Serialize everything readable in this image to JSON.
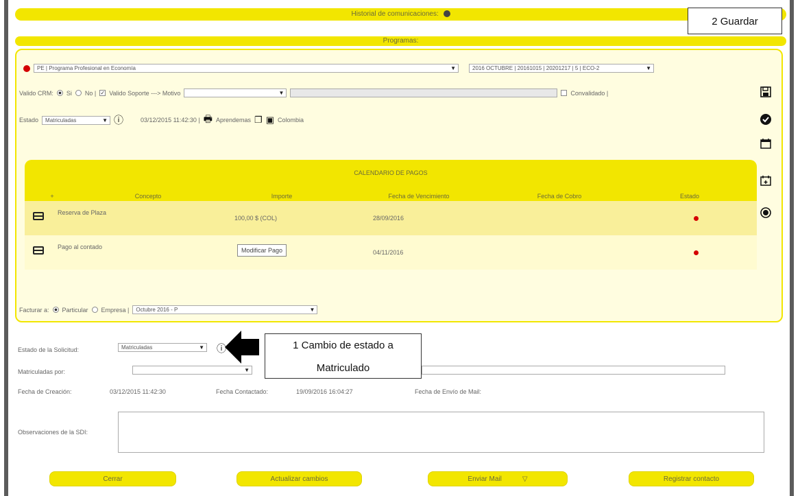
{
  "header": {
    "historial_label": "Historial de comunicaciones:",
    "programas_label": "Programas:"
  },
  "callouts": {
    "guardar": "2 Guardar",
    "cambio_line1": "1 Cambio de estado a",
    "cambio_line2": "Matriculado"
  },
  "program": {
    "program_select": "PE | Programa Profesional en Economía",
    "period_select": "2016 OCTUBRE | 20161015 | 20201217 | 5 | ECO-2",
    "valido_crm_label": "Valido CRM:",
    "si_label": "Si",
    "no_label": "No |",
    "valido_soporte_label": "Valido Soporte ---> Motivo",
    "convalidado_label": "Convalidado |",
    "estado_label": "Estado",
    "estado_value": "Matriculadas",
    "timestamp": "03/12/2015 11:42:30 |",
    "aprendemas_label": "Aprendemas",
    "country": "Colombia"
  },
  "calendar": {
    "title": "CALENDARIO DE PAGOS",
    "columns": [
      "+",
      "Concepto",
      "Importe",
      "Fecha de Vencimiento",
      "Fecha de Cobro",
      "Estado"
    ],
    "rows": [
      {
        "concepto": "Reserva de Plaza",
        "importe": "100,00 $ (COL)",
        "vencimiento": "28/09/2016"
      },
      {
        "concepto": "Pago al contado",
        "importe": "Modificar Pago",
        "vencimiento": "04/11/2016"
      }
    ]
  },
  "facturar": {
    "label": "Facturar a:",
    "particular": "Particular",
    "empresa": "Empresa |",
    "select": "Octubre 2016 - P"
  },
  "solicitud": {
    "estado_label": "Estado de la Solicitud:",
    "estado_value": "Matriculadas",
    "matriculadas_por_label": "Matriculadas por:",
    "fecha_creacion_label": "Fecha de Creación:",
    "fecha_creacion": "03/12/2015 11:42:30",
    "fecha_contactado_label": "Fecha Contactado:",
    "fecha_contactado": "19/09/2016 16:04:27",
    "fecha_envio_label": "Fecha de Envío de Mail:",
    "observaciones_label": "Observaciones de la SDI:"
  },
  "buttons": {
    "cerrar": "Cerrar",
    "actualizar": "Actualizar cambios",
    "enviar": "Enviar Mail",
    "registrar": "Registrar contacto"
  },
  "icons": [
    "save-icon",
    "check-circle-icon",
    "calendar-icon",
    "calendar-add-icon",
    "close-circle-icon"
  ]
}
